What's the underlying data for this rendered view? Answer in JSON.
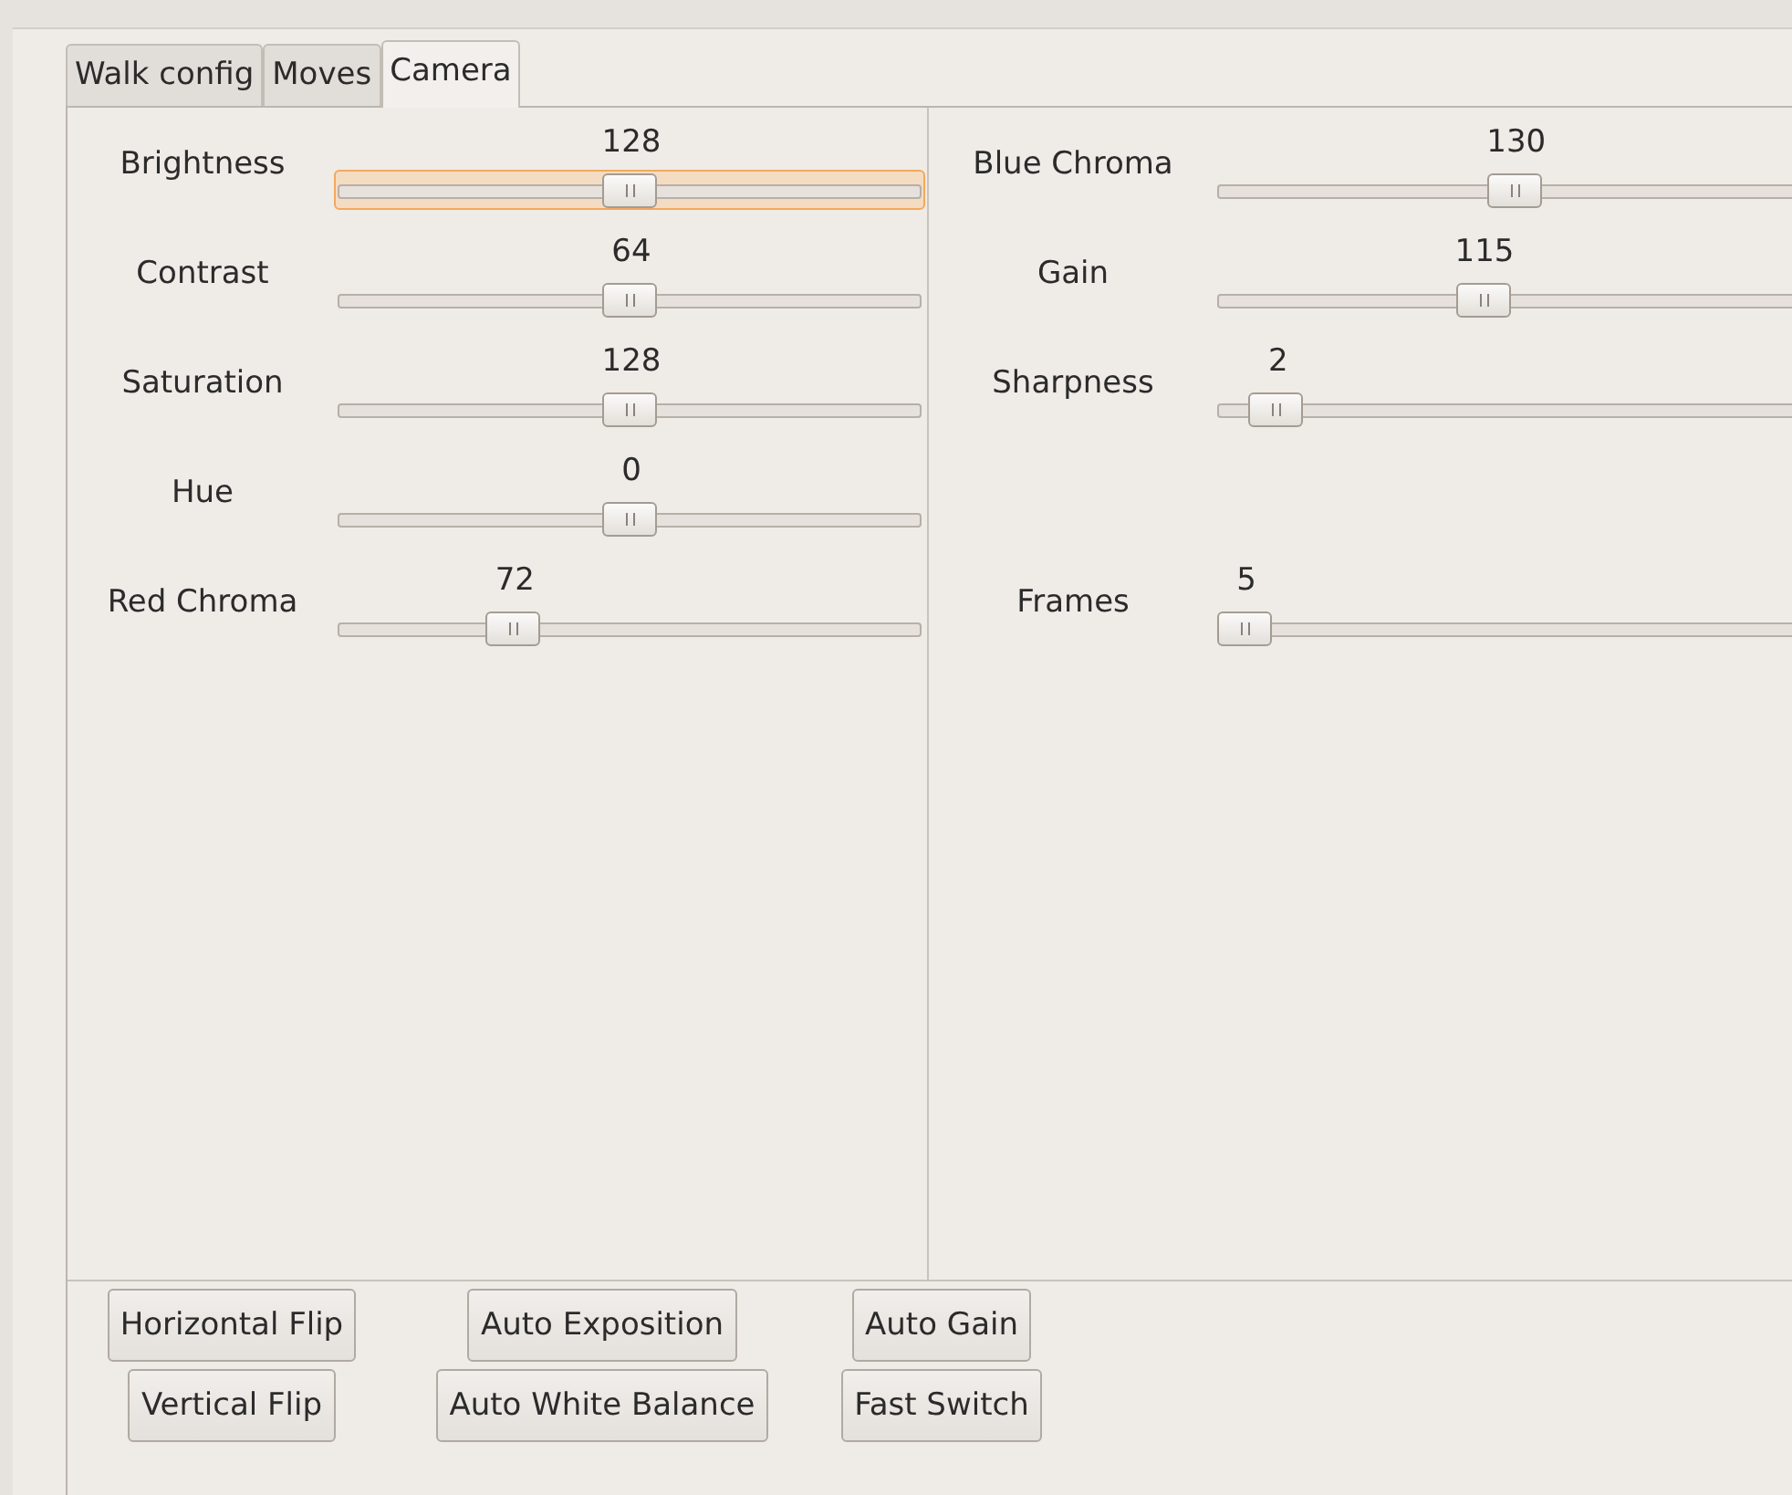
{
  "tabs": [
    {
      "label": "Walk config",
      "selected": false
    },
    {
      "label": "Moves",
      "selected": false
    },
    {
      "label": "Camera",
      "selected": true
    }
  ],
  "left_sliders": [
    {
      "kind": "slider",
      "label": "Brightness",
      "value": "128",
      "level": 0.5,
      "focused": true
    },
    {
      "kind": "slider",
      "label": "Contrast",
      "value": "64",
      "level": 0.5,
      "focused": false
    },
    {
      "kind": "slider",
      "label": "Saturation",
      "value": "128",
      "level": 0.5,
      "focused": false
    },
    {
      "kind": "slider",
      "label": "Hue",
      "value": "0",
      "level": 0.5,
      "focused": false
    },
    {
      "kind": "slider",
      "label": "Red Chroma",
      "value": "72",
      "level": 0.28,
      "focused": false
    }
  ],
  "right_sliders": [
    {
      "kind": "slider",
      "label": "Blue Chroma",
      "value": "130",
      "level": 0.51,
      "focused": false
    },
    {
      "kind": "slider",
      "label": "Gain",
      "value": "115",
      "level": 0.45,
      "focused": false
    },
    {
      "kind": "slider",
      "label": "Sharpness",
      "value": "2",
      "level": 0.06,
      "focused": false
    },
    {
      "kind": "blank"
    },
    {
      "kind": "slider",
      "label": "Frames",
      "value": "5",
      "level": 0,
      "focused": false
    }
  ],
  "buttons": [
    [
      "Horizontal Flip",
      "Auto Exposition",
      "Auto Gain"
    ],
    [
      "Vertical Flip",
      "Auto White Balance",
      "Fast Switch"
    ]
  ]
}
